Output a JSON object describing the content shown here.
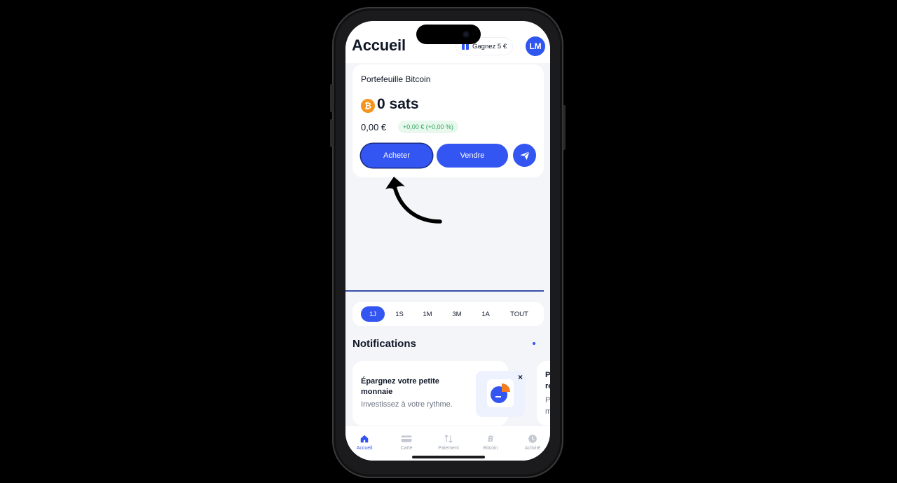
{
  "header": {
    "title": "Accueil",
    "earn_label": "Gagnez 5 €",
    "avatar_initials": "LM"
  },
  "wallet": {
    "title": "Portefeuille Bitcoin",
    "btc_symbol": "₿",
    "balance": "0 sats",
    "fiat_value": "0,00 €",
    "change": "+0,00 € (+0,00 %)",
    "buy_label": "Acheter",
    "sell_label": "Vendre"
  },
  "range": {
    "options": [
      "1J",
      "1S",
      "1M",
      "3M",
      "1A",
      "TOUT"
    ],
    "selected": "1J"
  },
  "notifications": {
    "title": "Notifications",
    "card": {
      "heading": "Épargnez votre petite monnaie",
      "subtitle": "Investissez à votre rythme.",
      "close": "×"
    },
    "next_card_letters": [
      "P",
      "re",
      "P",
      "m"
    ]
  },
  "tabs": [
    {
      "label": "Accueil",
      "icon": "home-icon",
      "active": true
    },
    {
      "label": "Carte",
      "icon": "card-icon",
      "active": false
    },
    {
      "label": "Paiement",
      "icon": "transfer-icon",
      "active": false
    },
    {
      "label": "Bitcoin",
      "icon": "bitcoin-icon",
      "active": false
    },
    {
      "label": "Activité",
      "icon": "clock-icon",
      "active": false
    }
  ],
  "colors": {
    "accent": "#3355f2",
    "bitcoin": "#f7931a",
    "positive": "#2fa65a"
  }
}
